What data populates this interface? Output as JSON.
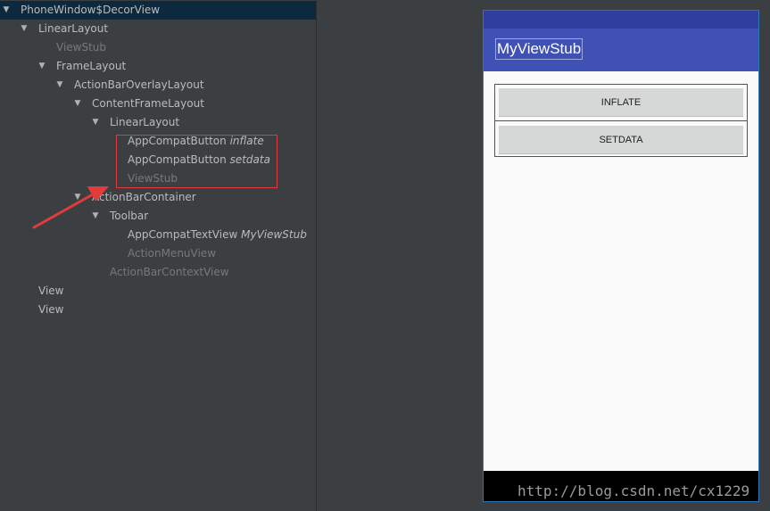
{
  "tree": {
    "nodes": [
      {
        "label": "PhoneWindow$DecorView",
        "detail": "",
        "toggle": "▼"
      },
      {
        "label": "LinearLayout",
        "detail": "",
        "toggle": "▼"
      },
      {
        "label": "ViewStub",
        "detail": "",
        "toggle": ""
      },
      {
        "label": "FrameLayout",
        "detail": "",
        "toggle": "▼"
      },
      {
        "label": "ActionBarOverlayLayout",
        "detail": "",
        "toggle": "▼"
      },
      {
        "label": "ContentFrameLayout",
        "detail": "",
        "toggle": "▼"
      },
      {
        "label": "LinearLayout",
        "detail": "",
        "toggle": "▼"
      },
      {
        "label": "AppCompatButton",
        "detail": "inflate",
        "toggle": ""
      },
      {
        "label": "AppCompatButton",
        "detail": "setdata",
        "toggle": ""
      },
      {
        "label": "ViewStub",
        "detail": "",
        "toggle": ""
      },
      {
        "label": "ActionBarContainer",
        "detail": "",
        "toggle": "▼"
      },
      {
        "label": "Toolbar",
        "detail": "",
        "toggle": "▼"
      },
      {
        "label": "AppCompatTextView",
        "detail": "MyViewStub",
        "toggle": ""
      },
      {
        "label": "ActionMenuView",
        "detail": "",
        "toggle": ""
      },
      {
        "label": "ActionBarContextView",
        "detail": "",
        "toggle": ""
      },
      {
        "label": "View",
        "detail": "",
        "toggle": ""
      },
      {
        "label": "View",
        "detail": "",
        "toggle": ""
      }
    ]
  },
  "device": {
    "toolbar_title": "MyViewStub",
    "buttons": [
      {
        "label": "INFLATE"
      },
      {
        "label": "SETDATA"
      }
    ]
  },
  "watermark": "http://blog.csdn.net/cx1229",
  "colors": {
    "panel_bg": "#3c3f41",
    "selection": "#0d293e",
    "primary": "#3f51b5",
    "primary_dark": "#303f9f",
    "highlight": "#e23b3b"
  }
}
